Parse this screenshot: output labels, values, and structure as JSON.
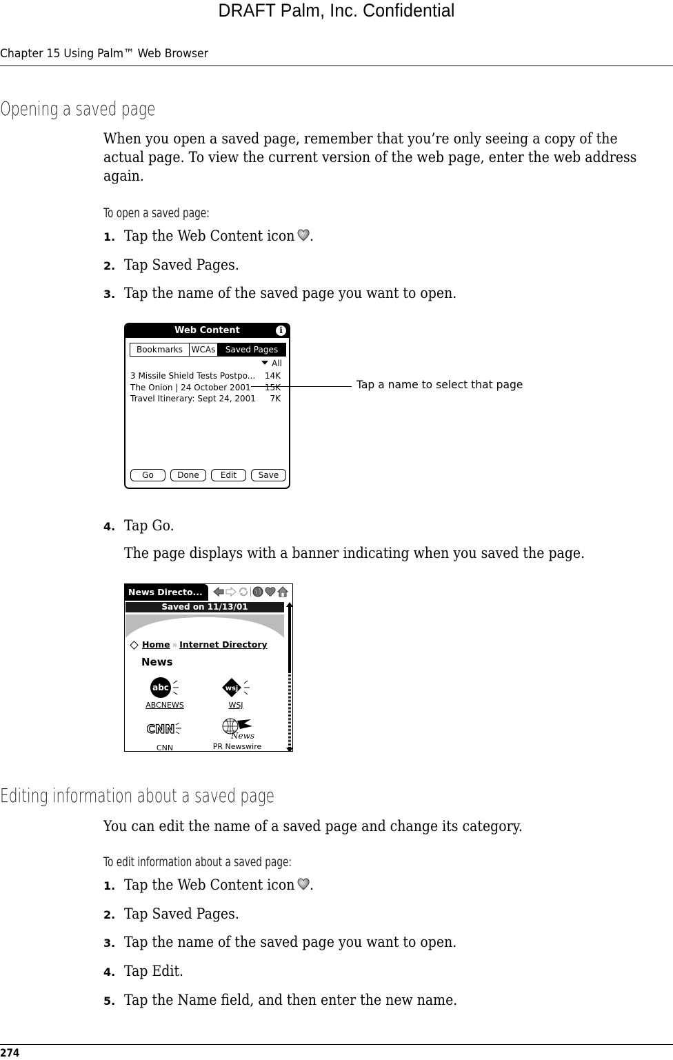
{
  "header": {
    "watermark": "DRAFT   Palm, Inc. Confidential",
    "chapter": "Chapter 15   Using Palm™ Web Browser"
  },
  "section1": {
    "heading": "Opening a saved page",
    "intro_lines": [
      "When you open a saved page, remember that you’re only seeing a copy of the",
      "actual page. To view the current version of the web page, enter the web address",
      "again."
    ],
    "procedure_title": "To open a saved page:",
    "steps": [
      {
        "num": "1.",
        "text": "Tap the Web Content icon",
        "suffix": ".",
        "icon": "heart-icon"
      },
      {
        "num": "2.",
        "text": "Tap Saved Pages."
      },
      {
        "num": "3.",
        "text": "Tap the name of the saved page you want to open."
      },
      {
        "num": "4.",
        "text": "Tap Go."
      }
    ],
    "step4_note": "The page displays with a banner indicating when you saved the page."
  },
  "screen1": {
    "title": "Web Content",
    "info_icon": "i",
    "tabs": [
      {
        "label": "Bookmarks",
        "active": false
      },
      {
        "label": "WCAs",
        "active": false
      },
      {
        "label": "Saved Pages",
        "active": true
      }
    ],
    "category": "All",
    "pages": [
      {
        "name": "3 Missile Shield Tests Postpo...",
        "size": "14K"
      },
      {
        "name": "The Onion | 24 October 2001",
        "size": "15K"
      },
      {
        "name": "Travel Itinerary: Sept 24, 2001",
        "size": "7K"
      }
    ],
    "buttons": [
      "Go",
      "Done",
      "Edit",
      "Save"
    ],
    "callout": "Tap a name to select that page"
  },
  "screen2": {
    "title": "News Directo...",
    "toolbar_icons": [
      "back-arrow-icon",
      "forward-arrow-icon",
      "refresh-icon",
      "globe-icon",
      "heart-icon",
      "home-icon"
    ],
    "banner": "Saved on 11/13/01",
    "breadcrumb": {
      "home": "Home",
      "separator": "»",
      "current": "Internet Directory"
    },
    "heading": "News",
    "links": [
      {
        "logo": "abc",
        "label": "ABCNEWS"
      },
      {
        "logo": "wsj",
        "label": "WSJ"
      },
      {
        "logo": "CNN",
        "label": "CNN"
      },
      {
        "logo": "News",
        "label": "PR Newswire"
      }
    ]
  },
  "section2": {
    "heading": "Editing information about a saved page",
    "intro": "You can edit the name of a saved page and change its category.",
    "procedure_title": "To edit information about a saved page:",
    "steps": [
      {
        "num": "1.",
        "text": "Tap the Web Content icon",
        "suffix": ".",
        "icon": "heart-icon"
      },
      {
        "num": "2.",
        "text": "Tap Saved Pages."
      },
      {
        "num": "3.",
        "text": "Tap the name of the saved page you want to open."
      },
      {
        "num": "4.",
        "text": "Tap Edit."
      },
      {
        "num": "5.",
        "text": "Tap the Name field, and then enter the new name."
      }
    ]
  },
  "footer": {
    "page_number": "274"
  }
}
